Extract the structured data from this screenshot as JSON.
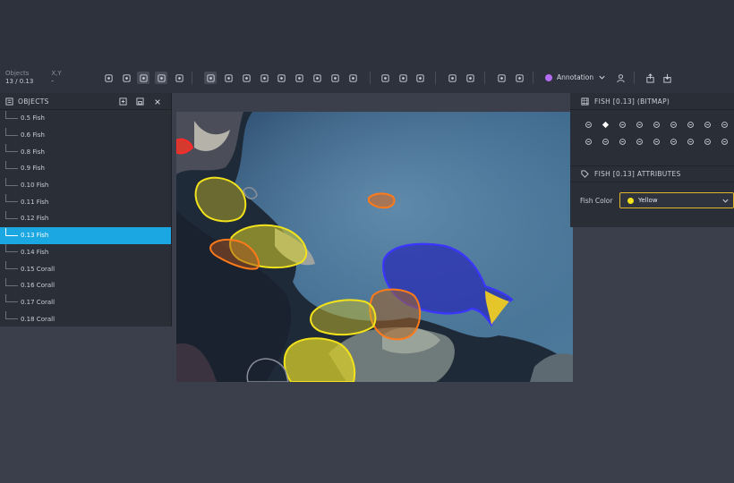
{
  "status": {
    "objects_label": "Objects",
    "objects_value": "13 / 0.13",
    "xy_label": "X,Y",
    "xy_value": "-"
  },
  "toolbar": {
    "tools": [
      {
        "name": "new-shape-icon",
        "active": false
      },
      {
        "name": "comment-icon",
        "active": false
      },
      {
        "name": "list-icon",
        "active": true
      },
      {
        "name": "mouse-icon",
        "active": true
      },
      {
        "name": "contrast-icon",
        "active": false
      },
      {
        "name": "duplicate-icon",
        "active": true
      },
      {
        "name": "bounding-box-icon",
        "active": false
      },
      {
        "name": "polygon-icon",
        "active": false
      },
      {
        "name": "brush-icon",
        "active": false
      },
      {
        "name": "target-icon",
        "active": false
      },
      {
        "name": "ai-tool-icon",
        "active": false
      },
      {
        "name": "magic-icon",
        "active": false
      },
      {
        "name": "smart-select-icon",
        "active": false
      },
      {
        "name": "timer-icon",
        "active": false
      },
      {
        "name": "crosshair-icon",
        "active": false
      },
      {
        "name": "add-comment-icon",
        "active": false
      },
      {
        "name": "ruler-icon",
        "active": false
      },
      {
        "name": "undo-icon",
        "active": false
      },
      {
        "name": "redo-icon",
        "active": false
      },
      {
        "name": "settings-icon",
        "active": false
      },
      {
        "name": "analytics-icon",
        "active": false
      }
    ],
    "mode_label": "Annotation",
    "mode_color": "#b46cf2"
  },
  "objects_panel": {
    "title": "OBJECTS",
    "items": [
      {
        "label": "0.5 Fish",
        "selected": false
      },
      {
        "label": "0.6 Fish",
        "selected": false
      },
      {
        "label": "0.8 Fish",
        "selected": false
      },
      {
        "label": "0.9 Fish",
        "selected": false
      },
      {
        "label": "0.10 Fish",
        "selected": false
      },
      {
        "label": "0.11 Fish",
        "selected": false
      },
      {
        "label": "0.12 Fish",
        "selected": false
      },
      {
        "label": "0.13 Fish",
        "selected": true
      },
      {
        "label": "0.14 Fish",
        "selected": false
      },
      {
        "label": "0.15 Corall",
        "selected": false
      },
      {
        "label": "0.16 Corall",
        "selected": false
      },
      {
        "label": "0.17 Corall",
        "selected": false
      },
      {
        "label": "0.18 Corall",
        "selected": false
      }
    ],
    "accent": "#1aa7e2"
  },
  "right_panel": {
    "title": "FISH [0.13] (BITMAP)",
    "attributes_title": "FISH [0.13] ATTRIBUTES",
    "color_label": "Fish Color",
    "color_value": "Yellow",
    "color_swatch": "#f2e21b",
    "tool_icons": [
      "comment-bubble-icon",
      "diamond-icon",
      "chevron-right-icon",
      "delete-icon",
      "eye-off-icon",
      "link-icon",
      "pencil-icon",
      "layers-icon",
      "swap-icon",
      "chat-icon",
      "chat-dots-icon",
      "brush-erase-icon",
      "fill-icon",
      "magic-wand-icon",
      "edit-brush-icon",
      "copy-icon",
      "grid-icon",
      "move-icon"
    ]
  }
}
